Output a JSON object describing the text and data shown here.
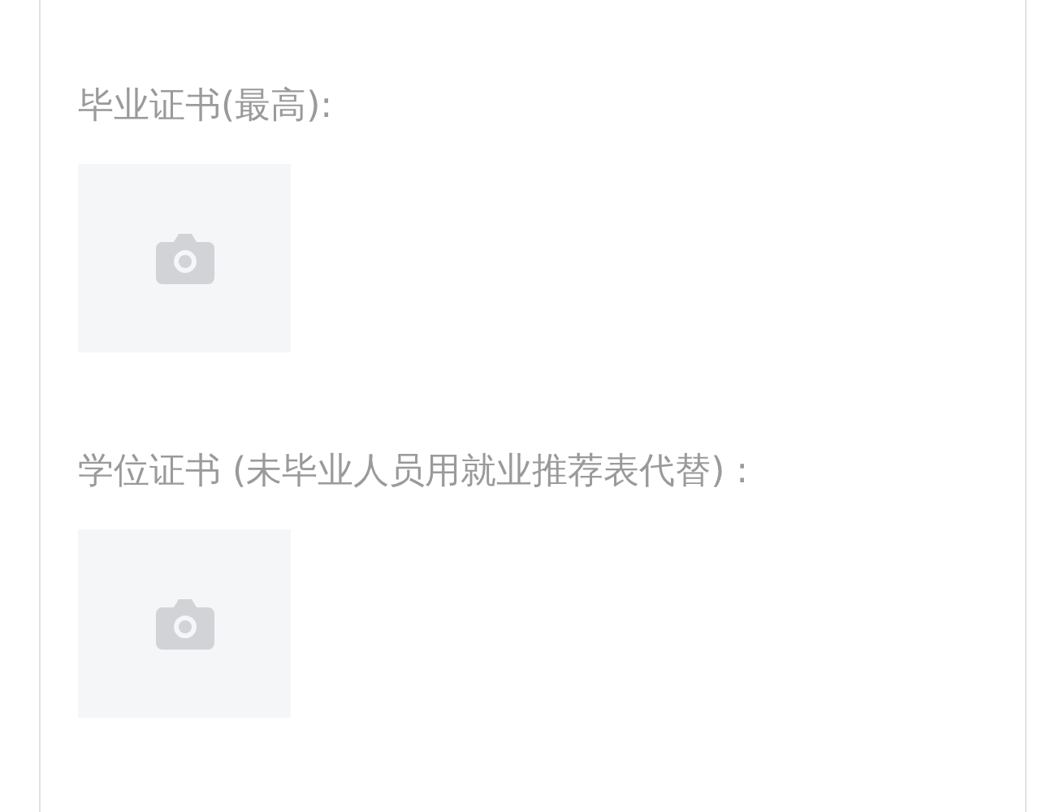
{
  "fields": [
    {
      "label": "毕业证书(最高):",
      "upload": {
        "kind": "picture-upload"
      }
    },
    {
      "label": "学位证书 (未毕业人员用就业推荐表代替) :",
      "upload": {
        "kind": "picture-upload"
      }
    }
  ]
}
